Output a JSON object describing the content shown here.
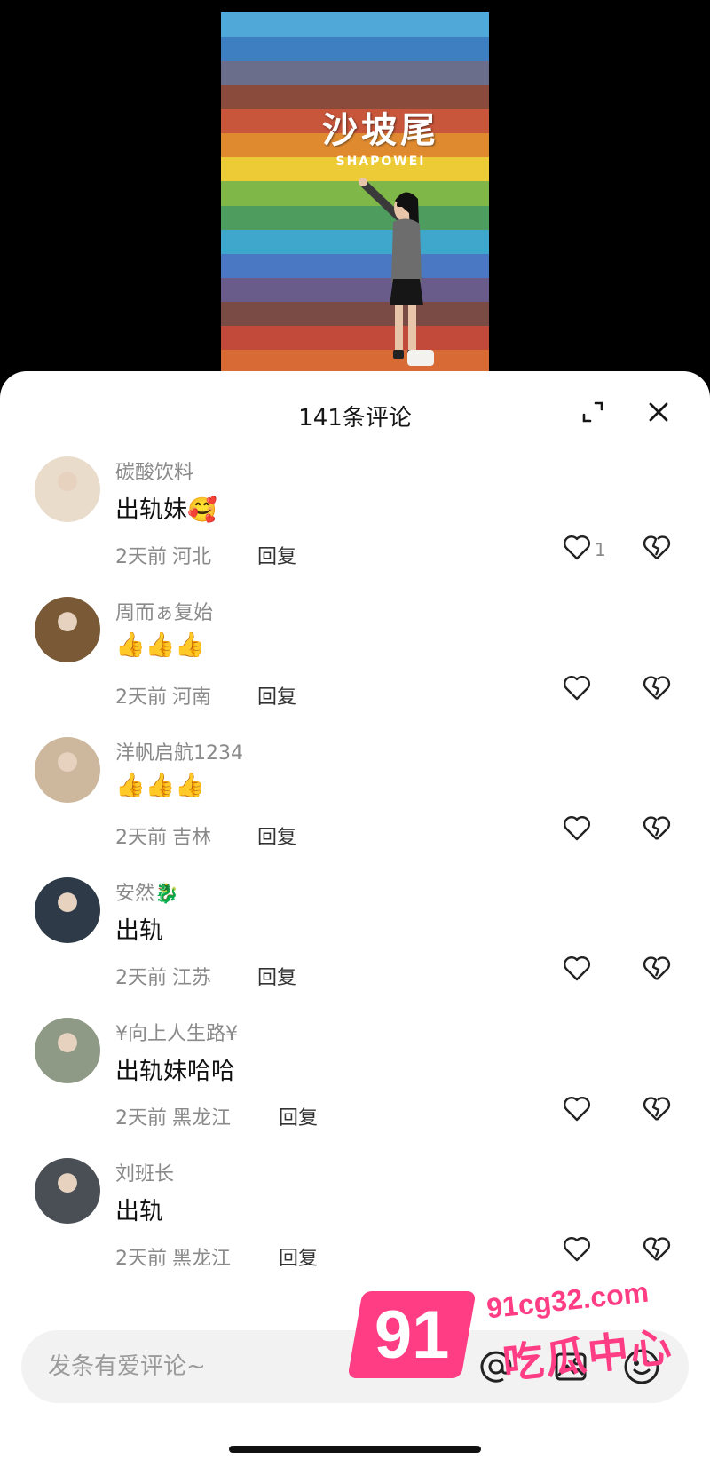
{
  "video": {
    "sign_cn": "沙坡尾",
    "sign_en": "SHAPOWEI",
    "stripe_colors": [
      "#4fa8d8",
      "#3d7fc0",
      "#6b6e8a",
      "#8a4a3c",
      "#c8563a",
      "#e08a30",
      "#eccb36",
      "#7fb848",
      "#4e9c5e",
      "#3fa6cc",
      "#4a78c2",
      "#6a5c8a",
      "#7a4a44",
      "#c14a3a",
      "#d86a36"
    ]
  },
  "sheet": {
    "title": "141条评论",
    "expand_icon": "expand-icon",
    "close_icon": "close-icon"
  },
  "comments": [
    {
      "user": "碳酸饮料",
      "text": "出轨妹🥰",
      "time": "2天前",
      "region": "河北",
      "reply": "回复",
      "likes": "1",
      "avatar_color": "#e9dccb"
    },
    {
      "user": "周而ぁ复始",
      "text": "👍👍👍",
      "time": "2天前",
      "region": "河南",
      "reply": "回复",
      "likes": "",
      "avatar_color": "#7a5a36"
    },
    {
      "user": "洋帆启航1234",
      "text": "👍👍👍",
      "time": "2天前",
      "region": "吉林",
      "reply": "回复",
      "likes": "",
      "avatar_color": "#cdb89e"
    },
    {
      "user": "安然🐉",
      "text": "出轨",
      "time": "2天前",
      "region": "江苏",
      "reply": "回复",
      "likes": "",
      "avatar_color": "#2e3a48"
    },
    {
      "user": "¥向上人生路¥",
      "text": "出轨妹哈哈",
      "time": "2天前",
      "region": "黑龙江",
      "reply": "回复",
      "likes": "",
      "avatar_color": "#8f9a86"
    },
    {
      "user": "刘班长",
      "text": "出轨",
      "time": "2天前",
      "region": "黑龙江",
      "reply": "回复",
      "likes": "",
      "avatar_color": "#4a4f55"
    }
  ],
  "input": {
    "placeholder": "发条有爱评论~"
  },
  "watermark": {
    "number": "91",
    "site": "91cg32.com",
    "name": "吃瓜中心",
    "color": "#ff3d85"
  }
}
